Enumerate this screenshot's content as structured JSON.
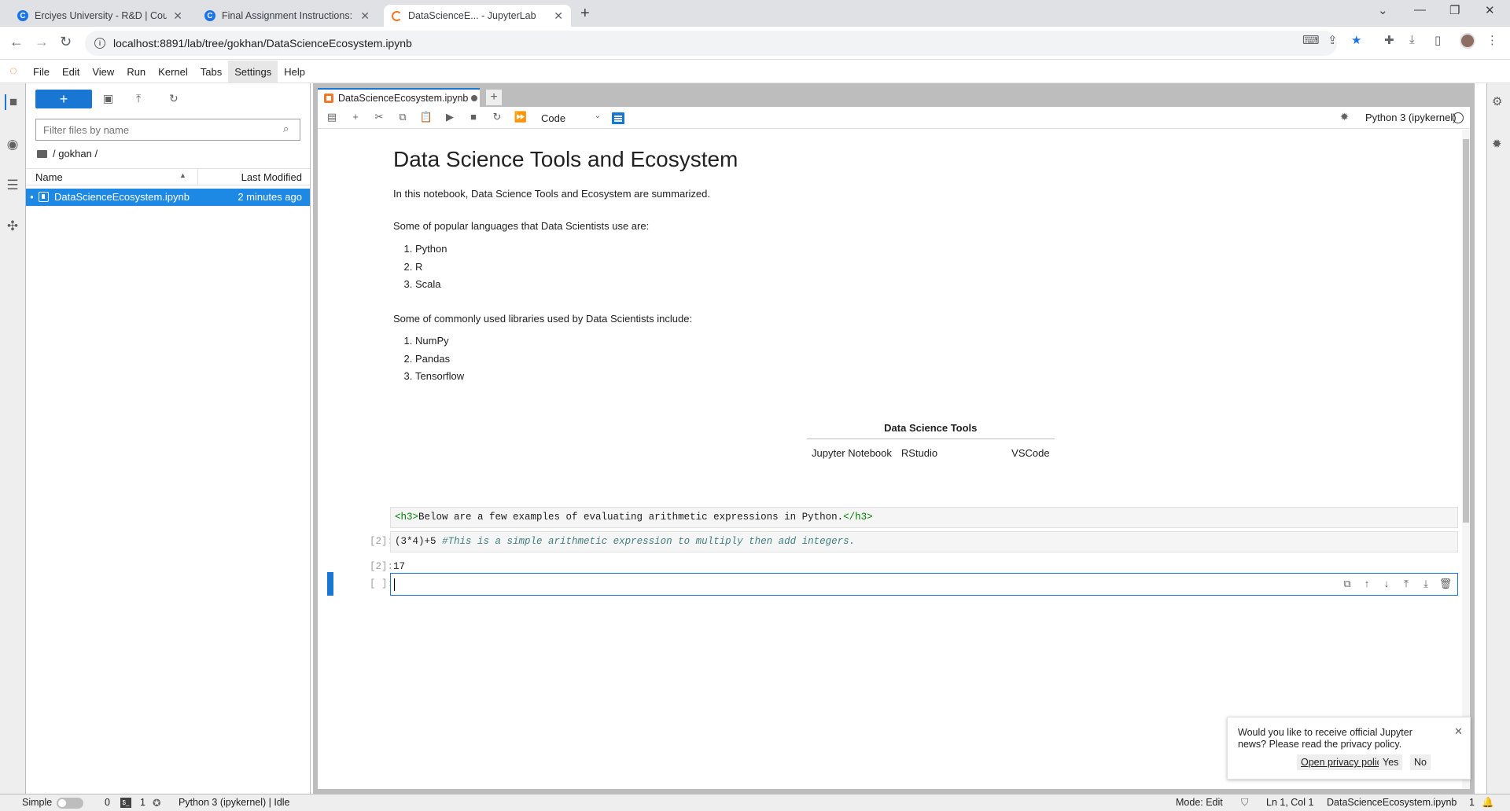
{
  "browser": {
    "tabs": [
      {
        "title": "Erciyes University - R&D | Course",
        "favicon": "C"
      },
      {
        "title": "Final Assignment Instructions: Cr",
        "favicon": "C"
      },
      {
        "title": "DataScienceE... - JupyterLab",
        "favicon": "jupyter"
      }
    ],
    "new_tab": "+",
    "url": "localhost:8891/lab/tree/gokhan/DataScienceEcosystem.ipynb"
  },
  "menubar": {
    "items": [
      "File",
      "Edit",
      "View",
      "Run",
      "Kernel",
      "Tabs",
      "Settings",
      "Help"
    ]
  },
  "filebrowser": {
    "new_label": "+",
    "filter_placeholder": "Filter files by name",
    "breadcrumb": "/ gokhan /",
    "col_name": "Name",
    "col_modified": "Last Modified",
    "files": [
      {
        "name": "DataScienceEcosystem.ipynb",
        "modified": "2 minutes ago"
      }
    ]
  },
  "notebook": {
    "tab_title": "DataScienceEcosystem.ipynb",
    "cell_type": "Code",
    "kernel_name": "Python 3 (ipykernel)",
    "title": "Data Science Tools and Ecosystem",
    "intro": "In this notebook, Data Science Tools and Ecosystem are summarized.",
    "languages_intro": "Some of popular languages that Data Scientists use are:",
    "languages": [
      "Python",
      "R",
      "Scala"
    ],
    "libraries_intro": "Some of commonly used libraries used by Data Scientists include:",
    "libraries": [
      "NumPy",
      "Pandas",
      "Tensorflow"
    ],
    "table_header": "Data Science Tools",
    "table_row": [
      "Jupyter Notebook",
      "RStudio",
      "VSCode"
    ],
    "cell1_tag_open": "<h3>",
    "cell1_text": "Below are a few examples of evaluating arithmetic expressions in Python.",
    "cell1_tag_close": "</h3>",
    "cell2_prompt": "[2]:",
    "cell2_code": "(3*4)+5",
    "cell2_comment": "#This is a simple arithmetic expression to multiply then add integers.",
    "out2_prompt": "[2]:",
    "out2_value": "17",
    "cell3_prompt": "[ ]:"
  },
  "notification": {
    "message": "Would you like to receive official Jupyter news? Please read the privacy policy.",
    "link": "Open privacy policy",
    "yes": "Yes",
    "no": "No"
  },
  "statusbar": {
    "mode_label": "Simple",
    "count1": "0",
    "count2": "1",
    "kernel": "Python 3 (ipykernel) | Idle",
    "mode": "Mode: Edit",
    "position": "Ln 1, Col 1",
    "file": "DataScienceEcosystem.ipynb",
    "notif_count": "1"
  },
  "colors": {
    "accent": "#1976d2",
    "jupyter_orange": "#f37726",
    "selection": "#1e88e5"
  }
}
